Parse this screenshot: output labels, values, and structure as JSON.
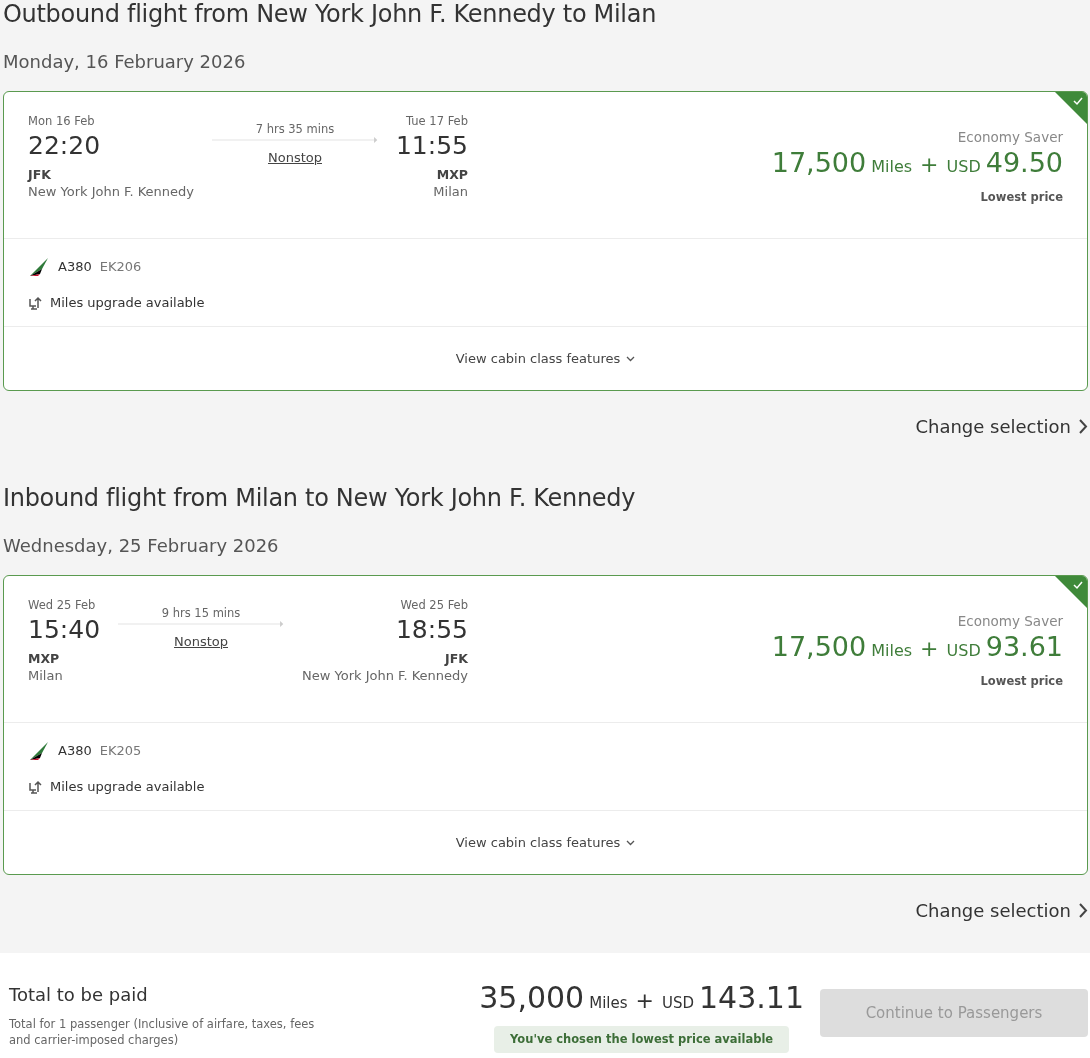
{
  "flights": [
    {
      "heading": "Outbound flight from New York John F. Kennedy to Milan",
      "date": "Monday, 16 February 2026",
      "selected": true,
      "depart": {
        "date": "Mon 16 Feb",
        "time": "22:20",
        "code": "JFK",
        "city": "New York John F. Kennedy"
      },
      "duration": "7 hrs 35 mins",
      "stops": "Nonstop",
      "arrive": {
        "date": "Tue 17 Feb",
        "time": "11:55",
        "code": "MXP",
        "city": "Milan"
      },
      "fare": {
        "cabin": "Economy Saver",
        "miles": "17,500",
        "miles_unit": "Miles",
        "plus": "+",
        "currency": "USD",
        "amount": "49.50",
        "note": "Lowest price"
      },
      "aircraft": "A380",
      "flight_number": "EK206",
      "upgrade": "Miles upgrade available",
      "features": "View cabin class features",
      "change": "Change selection"
    },
    {
      "heading": "Inbound flight from Milan to New York John F. Kennedy",
      "date": "Wednesday, 25 February 2026",
      "selected": true,
      "depart": {
        "date": "Wed 25 Feb",
        "time": "15:40",
        "code": "MXP",
        "city": "Milan"
      },
      "duration": "9 hrs 15 mins",
      "stops": "Nonstop",
      "arrive": {
        "date": "Wed 25 Feb",
        "time": "18:55",
        "code": "JFK",
        "city": "New York John F. Kennedy"
      },
      "fare": {
        "cabin": "Economy Saver",
        "miles": "17,500",
        "miles_unit": "Miles",
        "plus": "+",
        "currency": "USD",
        "amount": "93.61",
        "note": "Lowest price"
      },
      "aircraft": "A380",
      "flight_number": "EK205",
      "upgrade": "Miles upgrade available",
      "features": "View cabin class features",
      "change": "Change selection"
    }
  ],
  "total": {
    "title": "Total to be paid",
    "note": "Total for 1 passenger (Inclusive of airfare, taxes, fees and carrier-imposed charges)",
    "miles": "35,000",
    "miles_unit": "Miles",
    "plus": "+",
    "currency": "USD",
    "amount": "143.11",
    "badge": "You've chosen the lowest price available",
    "button": {
      "label": "Continue to Passengers",
      "disabled": true
    }
  }
}
